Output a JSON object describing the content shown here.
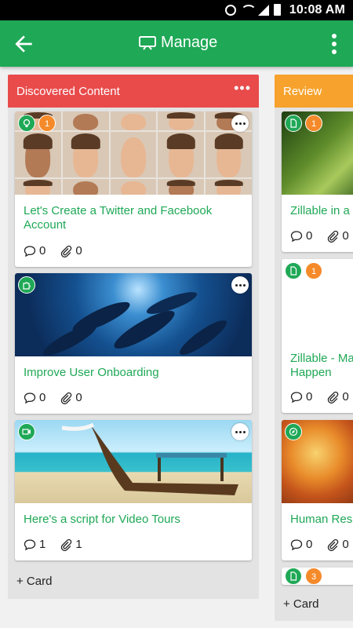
{
  "status_bar": {
    "time": "10:08 AM"
  },
  "app_bar": {
    "title": "Manage"
  },
  "colors": {
    "app_bar": "#1fa856",
    "list_discovered": "#e94b4b",
    "list_review": "#f6a22c",
    "card_title": "#1fa856",
    "count_badge": "#f58a2a"
  },
  "lists": [
    {
      "title": "Discovered Content",
      "add_label": "+ Card",
      "cards": [
        {
          "title": "Let's Create a Twitter and Facebook Account",
          "type_icon": "lightbulb-icon",
          "badge": "1",
          "comments": "0",
          "attachments": "0",
          "image": "grid of expressive faces"
        },
        {
          "title": "Improve User Onboarding",
          "type_icon": "puzzle-icon",
          "badge": "",
          "comments": "0",
          "attachments": "0",
          "image": "whales underwater"
        },
        {
          "title": "Here's a script for Video Tours",
          "type_icon": "video-icon",
          "badge": "",
          "comments": "1",
          "attachments": "1",
          "image": "longtail boat on beach"
        }
      ]
    },
    {
      "title": "Review",
      "add_label": "+ Card",
      "cards": [
        {
          "title": "Zillable in a",
          "type_icon": "document-icon",
          "badge": "1",
          "comments": "0",
          "attachments": "0",
          "image": "green leaf"
        },
        {
          "title": "Zillable - Ma Happen",
          "type_icon": "document-icon",
          "badge": "1",
          "comments": "0",
          "attachments": "0",
          "image": "blank"
        },
        {
          "title": "Human Reso",
          "type_icon": "compass-icon",
          "badge": "",
          "comments": "0",
          "attachments": "0",
          "image": "autumn leaves"
        },
        {
          "title": "",
          "type_icon": "document-icon",
          "badge": "3",
          "comments": "",
          "attachments": "",
          "image": "partially visible"
        }
      ]
    }
  ]
}
